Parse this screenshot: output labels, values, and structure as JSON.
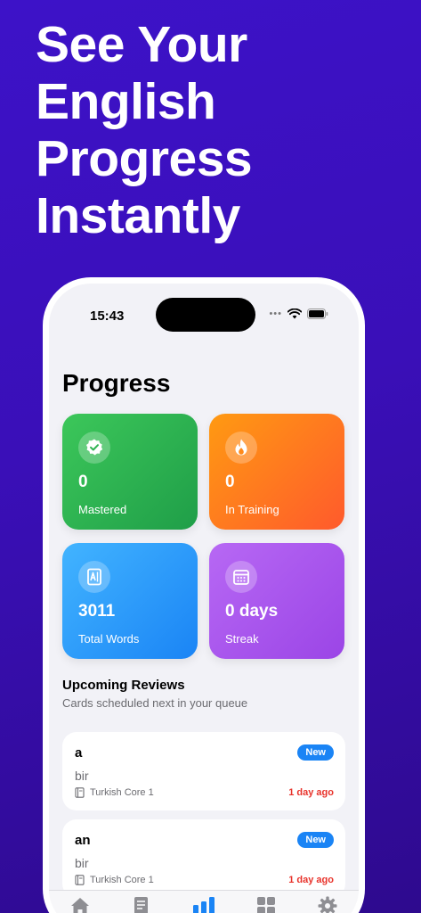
{
  "headline": {
    "line1": "See Your",
    "line2": "English",
    "line3": "Progress",
    "line4": "Instantly"
  },
  "status": {
    "time": "15:43",
    "dots": "•••"
  },
  "page": {
    "title": "Progress"
  },
  "stats": {
    "mastered": {
      "value": "0",
      "label": "Mastered",
      "icon": "checkmark-seal-icon"
    },
    "training": {
      "value": "0",
      "label": "In Training",
      "icon": "flame-icon"
    },
    "total": {
      "value": "3011",
      "label": "Total Words",
      "icon": "dictionary-icon"
    },
    "streak": {
      "value": "0 days",
      "label": "Streak",
      "icon": "calendar-icon"
    }
  },
  "upcoming": {
    "title": "Upcoming Reviews",
    "subtitle": "Cards scheduled next in your queue",
    "items": [
      {
        "word": "a",
        "translation": "bir",
        "deck": "Turkish Core 1",
        "badge": "New",
        "due": "1 day ago"
      },
      {
        "word": "an",
        "translation": "bir",
        "deck": "Turkish Core 1",
        "badge": "New",
        "due": "1 day ago"
      }
    ]
  },
  "tabs": [
    {
      "icon": "home-icon",
      "active": false
    },
    {
      "icon": "document-icon",
      "active": false
    },
    {
      "icon": "bar-chart-icon",
      "active": true
    },
    {
      "icon": "grid-icon",
      "active": false
    },
    {
      "icon": "gear-icon",
      "active": false
    }
  ],
  "colors": {
    "background": "#3a0fb8",
    "accent": "#1a84f5",
    "due": "#e8332b",
    "mastered": "#2fb352",
    "training": "#ff7a1e",
    "total": "#2e9cfb",
    "streak": "#a957ec"
  }
}
